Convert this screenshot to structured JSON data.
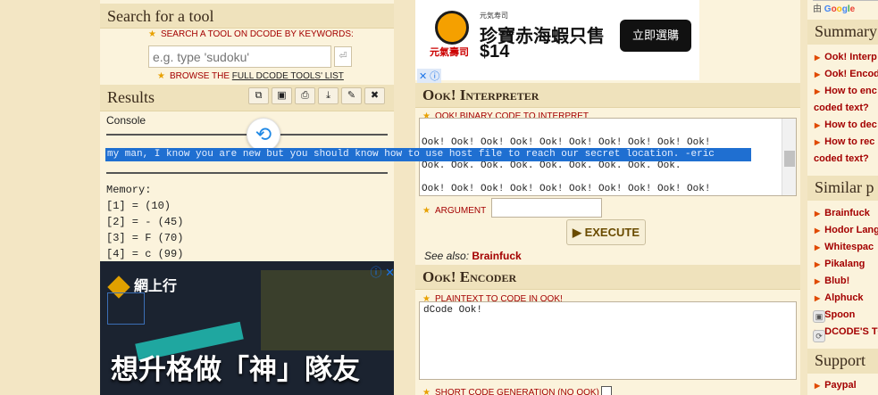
{
  "search": {
    "title": "Search for a tool",
    "keyword_label": "SEARCH A TOOL ON DCODE BY KEYWORDS:",
    "placeholder": "e.g. type 'sudoku'",
    "browse_prefix": "BROWSE THE ",
    "browse_link": "FULL DCODE TOOLS' LIST"
  },
  "results": {
    "title": "Results",
    "tools": [
      "copy-icon",
      "save-icon",
      "print-icon",
      "download-icon",
      "pin-icon",
      "close-icon"
    ],
    "console_label": "Console",
    "highlighted_text": "my man, I know you are new but you should know how to use host file to reach our secret location. -eric",
    "memory": "Memory:\n[1] = (10)\n[2] = - (45)\n[3] = F (70)\n[4] = c (99)"
  },
  "ad_left": {
    "brand": "網上行",
    "headline": "想升格做「神」隊友"
  },
  "ad_top": {
    "small": "元気寿司",
    "headline": "珍寶赤海蝦只售",
    "price": "$14",
    "brand_caption": "元氣壽司",
    "cta": "立即選購"
  },
  "interpreter": {
    "title": "Ook! Interpreter",
    "field_label": "OOK! BINARY CODE TO INTERPRET",
    "code": "Ook! Ook! Ook! Ook! Ook! Ook! Ook! Ook! Ook! Ook!\nOok! Ook! Ook. Ook. Ook. Ook. Ook. Ook. Ook. Ook.\nOok. Ook. Ook. Ook. Ook. Ook. Ook. Ook. Ook.\n\nOok! Ook! Ook! Ook! Ook! Ook! Ook! Ook! Ook! Ook!\nOok! Ook! Ook! Ook! Ook! Ook! Ook! Ook! Ook! Ook!\nOok! Ook! Ook! Ook! Ook! Ook! Ook! Ook! Ook.",
    "argument_label": "ARGUMENT",
    "execute_label": "▶ EXECUTE",
    "see_also_prefix": "See also: ",
    "see_also_link": "Brainfuck"
  },
  "encoder": {
    "title": "Ook! Encoder",
    "field_label": "PLAINTEXT TO CODE IN OOK!",
    "text": "dCode Ook!",
    "short_label": "SHORT CODE GENERATION (NO OOK)"
  },
  "sidebar": {
    "google_prefix": "由",
    "summary_title": "Summary",
    "summary_items": [
      "Ook! Interp",
      "Ook! Encod",
      "How to enc",
      "coded text?",
      "How to dec",
      "How to rec",
      "coded text?"
    ],
    "similar_title": "Similar p",
    "similar_items": [
      "Brainfuck",
      "Hodor Lang",
      "Whitespac",
      "Pikalang",
      "Blub!",
      "Alphuck",
      "Spoon",
      "DCODE'S TO"
    ],
    "support_title": "Support",
    "support_items": [
      "Paypal"
    ]
  }
}
